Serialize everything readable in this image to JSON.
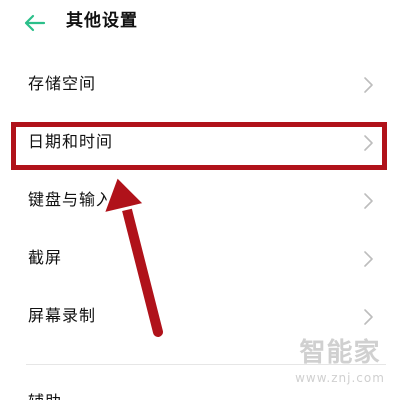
{
  "header": {
    "title": "其他设置",
    "back_icon": "back-arrow-icon",
    "back_icon_color": "#2bbf8a"
  },
  "settings": {
    "items": [
      {
        "label": "存储空间"
      },
      {
        "label": "日期和时间"
      },
      {
        "label": "键盘与输入法"
      },
      {
        "label": "截屏"
      },
      {
        "label": "屏幕录制"
      }
    ],
    "partial_item_label": "辅助"
  },
  "annotation": {
    "highlighted_item": "日期和时间",
    "color": "#b0121a"
  },
  "watermark": {
    "logo": "智能家",
    "url": "www.znj.com"
  }
}
